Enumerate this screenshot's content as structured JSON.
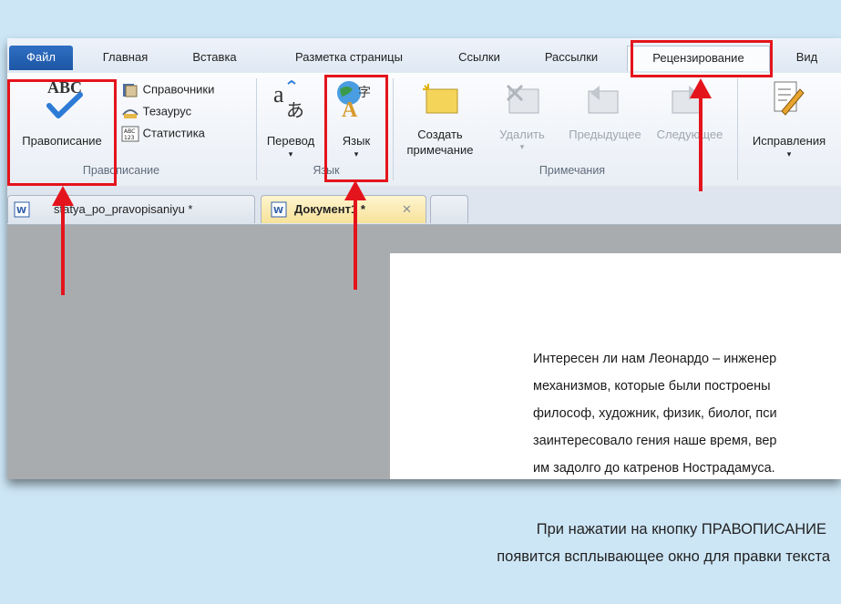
{
  "ribbon_tabs": {
    "file": "Файл",
    "home": "Главная",
    "insert": "Вставка",
    "layout": "Разметка страницы",
    "refs": "Ссылки",
    "mailings": "Рассылки",
    "review": "Рецензирование",
    "view": "Вид"
  },
  "proofing": {
    "spelling": "Правописание",
    "research": "Справочники",
    "thesaurus": "Тезаурус",
    "stats": "Статистика",
    "group": "Правописание",
    "abc": "ABC",
    "abc_small": "ABC",
    "num_small": "123"
  },
  "language": {
    "translate": "Перевод",
    "language": "Язык",
    "group": "Язык"
  },
  "comments": {
    "new_line1": "Создать",
    "new_line2": "примечание",
    "delete": "Удалить",
    "previous": "Предыдущее",
    "next": "Следующее",
    "group": "Примечания"
  },
  "tracking": {
    "track": "Исправления"
  },
  "doc_tabs": {
    "tab1": "statya_po_pravopisaniyu *",
    "tab2": "Документ1 *"
  },
  "document": {
    "lines": [
      "Интересен ли нам Леонардо – инженер",
      "механизмов, которые были построены",
      "философ, художник, физик, биолог, пси",
      "заинтересовало гения наше время, вер",
      "им задолго до катренов Нострадамуса."
    ]
  },
  "caption": {
    "line1": "При нажатии на кнопку  ПРАВОПИСАНИЕ",
    "line2": "появится всплывающее окно для правки текста"
  },
  "colors": {
    "highlight": "#e4141c",
    "file_tab": "#1d56a4",
    "slide_bg": "#cde6f6"
  },
  "icons": [
    "spelling-check-icon",
    "research-book-icon",
    "thesaurus-icon",
    "statistics-icon",
    "translate-icon",
    "language-globe-icon",
    "new-comment-icon",
    "delete-comment-icon",
    "previous-comment-icon",
    "next-comment-icon",
    "track-changes-icon",
    "word-doc-icon",
    "close-icon"
  ]
}
